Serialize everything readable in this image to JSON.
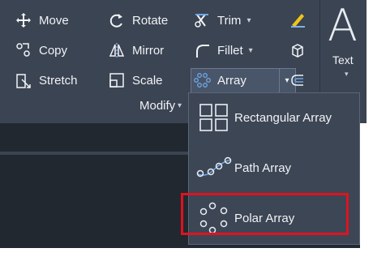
{
  "ribbon": {
    "row1": {
      "move": "Move",
      "rotate": "Rotate",
      "trim": "Trim"
    },
    "row2": {
      "copy": "Copy",
      "mirror": "Mirror",
      "fillet": "Fillet"
    },
    "row3": {
      "stretch": "Stretch",
      "scale": "Scale",
      "array": "Array"
    },
    "panel_label": "Modify",
    "text_tool_label": "Text",
    "text_tool_glyph": "A"
  },
  "array_menu": {
    "items": [
      {
        "label": "Rectangular Array"
      },
      {
        "label": "Path Array"
      },
      {
        "label": "Polar Array"
      }
    ],
    "highlighted_item": "Polar Array"
  },
  "colors": {
    "ribbon_bg": "#3b4453",
    "canvas_bg": "#212830",
    "highlight_border": "#e0121f",
    "icon_blue": "#6fa6e6"
  }
}
